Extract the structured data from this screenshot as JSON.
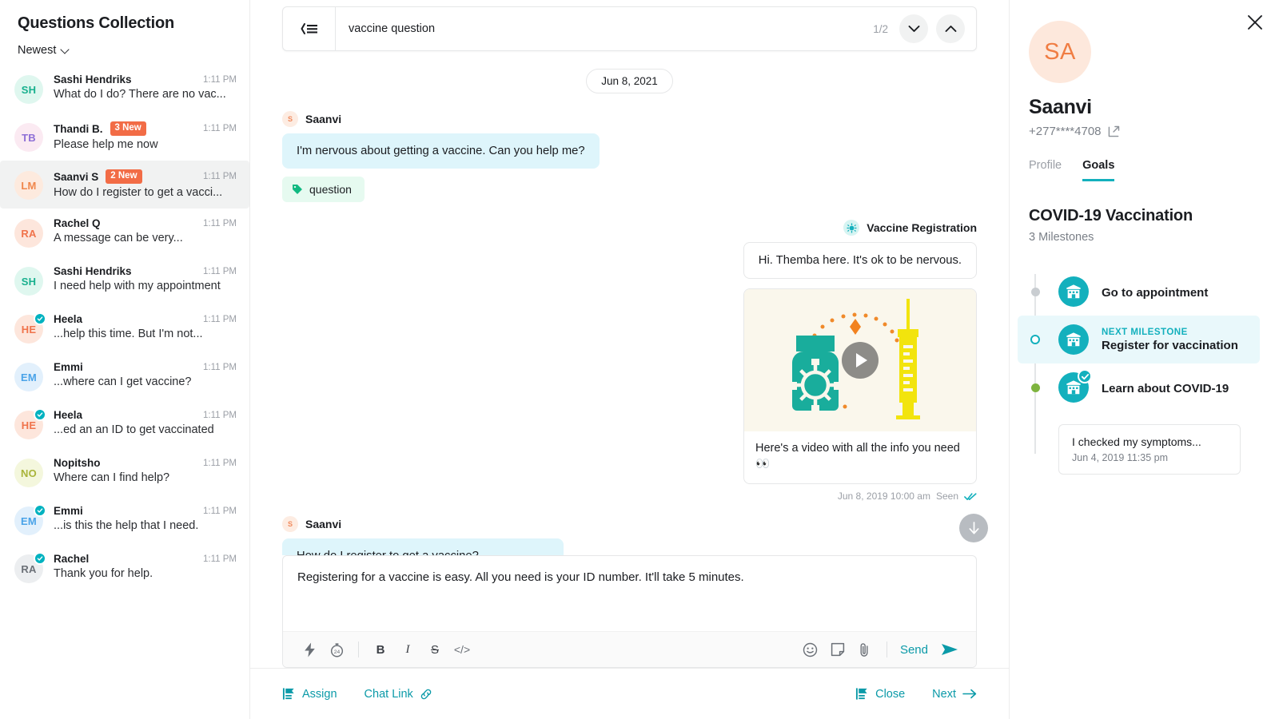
{
  "sidebar": {
    "title": "Questions Collection",
    "sort_label": "Newest",
    "conversations": [
      {
        "initials": "SH",
        "name": "Sashi Hendriks",
        "badge": "",
        "time": "1:11 PM",
        "preview": "What do I do? There are no vac...",
        "fg": "#18b08e",
        "bg": "#dff7ef",
        "verified": false,
        "active": false
      },
      {
        "initials": "TB",
        "name": "Thandi B.",
        "badge": "3 New",
        "time": "1:11 PM",
        "preview": "Please help me now",
        "fg": "#8e6fd6",
        "bg": "#fbeaf2",
        "verified": false,
        "active": false
      },
      {
        "initials": "LM",
        "name": "Saanvi S",
        "badge": "2 New",
        "time": "1:11 PM",
        "preview": "How do I register to get a vacci...",
        "fg": "#f0864b",
        "bg": "#fdeade",
        "verified": false,
        "active": true
      },
      {
        "initials": "RA",
        "name": "Rachel Q",
        "badge": "",
        "time": "1:11 PM",
        "preview": "A message can be very...",
        "fg": "#f0734b",
        "bg": "#fde6dc",
        "verified": false,
        "active": false
      },
      {
        "initials": "SH",
        "name": "Sashi Hendriks",
        "badge": "",
        "time": "1:11 PM",
        "preview": "I need help with my appointment",
        "fg": "#18b08e",
        "bg": "#dff7ef",
        "verified": false,
        "active": false
      },
      {
        "initials": "HE",
        "name": "Heela",
        "badge": "",
        "time": "1:11 PM",
        "preview": " ...help this time. But I'm not...",
        "fg": "#f0734b",
        "bg": "#fde6dc",
        "verified": true,
        "active": false
      },
      {
        "initials": "EM",
        "name": "Emmi",
        "badge": "",
        "time": "1:11 PM",
        "preview": "...where can I get vaccine?",
        "fg": "#4aa3e8",
        "bg": "#e2f0fc",
        "verified": false,
        "active": false
      },
      {
        "initials": "HE",
        "name": "Heela",
        "badge": "",
        "time": "1:11 PM",
        "preview": "...ed an an ID to get vaccinated",
        "fg": "#f0734b",
        "bg": "#fde6dc",
        "verified": true,
        "active": false
      },
      {
        "initials": "NO",
        "name": "Nopitsho",
        "badge": "",
        "time": "1:11 PM",
        "preview": "Where can I find help?",
        "fg": "#a9b43a",
        "bg": "#f4f7dd",
        "verified": false,
        "active": false
      },
      {
        "initials": "EM",
        "name": "Emmi",
        "badge": "",
        "time": "1:11 PM",
        "preview": "...is this the help that I need.",
        "fg": "#4aa3e8",
        "bg": "#e2f0fc",
        "verified": true,
        "active": false
      },
      {
        "initials": "RA",
        "name": "Rachel",
        "badge": "",
        "time": "1:11 PM",
        "preview": "Thank you for help.",
        "fg": "#6b7077",
        "bg": "#eceef0",
        "verified": true,
        "active": false
      }
    ]
  },
  "search": {
    "query": "vaccine question",
    "result_count": "1/2"
  },
  "thread": {
    "date_divider": "Jun 8, 2021",
    "m1": {
      "avatar_initial": "S",
      "author": "Saanvi",
      "text": "I'm nervous about getting a vaccine. Can you help me?",
      "tag": "question"
    },
    "m2": {
      "author": "Vaccine Registration",
      "text": "Hi. Themba here. It's ok to be nervous.",
      "video_caption": "Here's a video with all the info you need 👀",
      "status_time": "Jun 8, 2019 10:00 am",
      "status_label": "Seen"
    },
    "m3": {
      "avatar_initial": "S",
      "author": "Saanvi",
      "text": "How do I register to get a vaccine?"
    }
  },
  "composer": {
    "draft": "Registering for a vaccine is easy. All you need is your ID number. It'll take 5 minutes.",
    "bold_label": "B",
    "italic_label": "I",
    "strike_label": "S",
    "code_label": "</>",
    "send_label": "Send"
  },
  "actions": {
    "assign": "Assign",
    "chat_link": "Chat Link",
    "close": "Close",
    "next": "Next"
  },
  "contact": {
    "initials": "SA",
    "name": "Saanvi",
    "phone": "+277****4708",
    "tabs": [
      {
        "label": "Profile",
        "active": false
      },
      {
        "label": "Goals",
        "active": true
      }
    ]
  },
  "goals": {
    "title": "COVID-19 Vaccination",
    "subtitle": "3 Milestones",
    "milestones": [
      {
        "label": "Go to appointment",
        "kicker": "",
        "state": "pending",
        "completed": false
      },
      {
        "label": "Register for vaccination",
        "kicker": "NEXT MILESTONE",
        "state": "next",
        "completed": false
      },
      {
        "label": "Learn about COVID-19",
        "kicker": "",
        "state": "done",
        "completed": true
      }
    ],
    "symptom_card": {
      "text": "I checked my symptoms...",
      "time": "Jun 4, 2019 11:35 pm"
    }
  },
  "colors": {
    "accent": "#13b0bd",
    "badge": "#f26c46",
    "incoming_bubble": "#def5fb",
    "tag": "#e6faf0"
  }
}
